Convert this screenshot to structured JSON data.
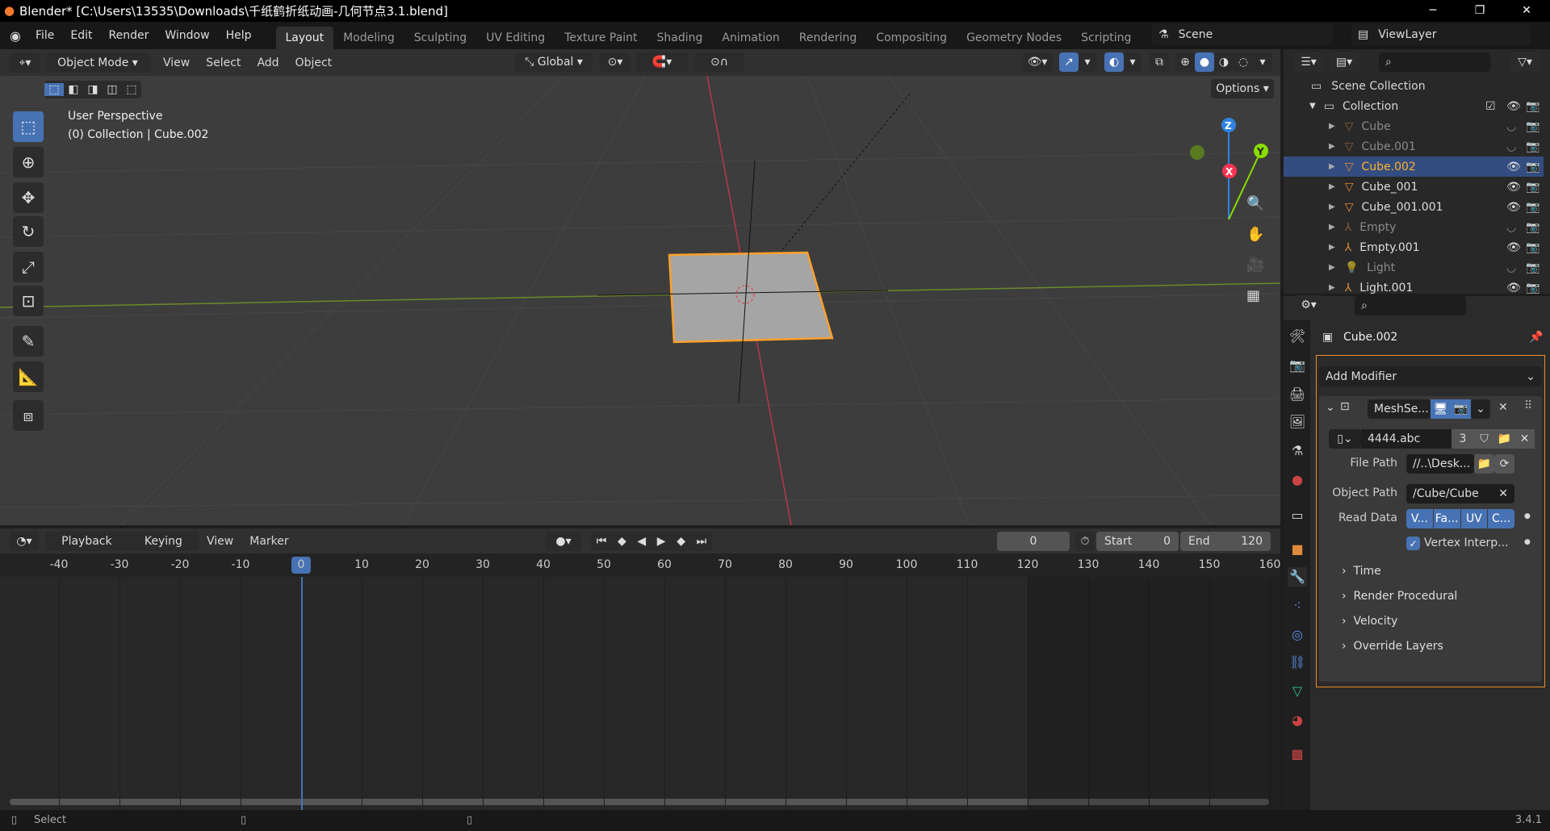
{
  "window": {
    "title": "Blender* [C:\\Users\\13535\\Downloads\\千纸鹤折纸动画-几何节点3.1.blend]",
    "minimize": "─",
    "maximize": "❐",
    "close": "✕"
  },
  "menu": [
    "File",
    "Edit",
    "Render",
    "Window",
    "Help"
  ],
  "workspaces": [
    "Layout",
    "Modeling",
    "Sculpting",
    "UV Editing",
    "Texture Paint",
    "Shading",
    "Animation",
    "Rendering",
    "Compositing",
    "Geometry Nodes",
    "Scripting",
    "+"
  ],
  "active_workspace": "Layout",
  "scene": {
    "name": "Scene",
    "view_layer": "ViewLayer"
  },
  "viewport": {
    "mode": "Object Mode",
    "menus": [
      "View",
      "Select",
      "Add",
      "Object"
    ],
    "transform_orientation": "Global",
    "options": "Options",
    "overlay_line1": "User Perspective",
    "overlay_line2": "(0) Collection | Cube.002",
    "gizmo": {
      "z": "Z",
      "y": "Y",
      "x": "X"
    }
  },
  "timeline": {
    "menus": [
      "Playback",
      "Keying",
      "View",
      "Marker"
    ],
    "current_frame": "0",
    "start_label": "Start",
    "start": "0",
    "end_label": "End",
    "end": "120",
    "ticks": [
      -40,
      -30,
      -20,
      -10,
      0,
      10,
      20,
      30,
      40,
      50,
      60,
      70,
      80,
      90,
      100,
      110,
      120,
      130,
      140,
      150,
      160
    ],
    "playhead": 0
  },
  "outliner": {
    "scene_collection": "Scene Collection",
    "collection": "Collection",
    "items": [
      {
        "name": "Cube",
        "type": "mesh",
        "hidden": true,
        "selected": false
      },
      {
        "name": "Cube.001",
        "type": "mesh",
        "hidden": true,
        "selected": false
      },
      {
        "name": "Cube.002",
        "type": "mesh",
        "hidden": false,
        "selected": true
      },
      {
        "name": "Cube_001",
        "type": "mesh",
        "hidden": false,
        "selected": false
      },
      {
        "name": "Cube_001.001",
        "type": "mesh",
        "hidden": false,
        "selected": false
      },
      {
        "name": "Empty",
        "type": "empty",
        "hidden": true,
        "selected": false
      },
      {
        "name": "Empty.001",
        "type": "empty",
        "hidden": false,
        "selected": false
      },
      {
        "name": "Light",
        "type": "light",
        "hidden": true,
        "selected": false
      },
      {
        "name": "Light.001",
        "type": "empty",
        "hidden": false,
        "selected": false
      }
    ]
  },
  "properties": {
    "object": "Cube.002",
    "add_modifier": "Add Modifier",
    "modifier": {
      "name": "MeshSe...",
      "cache_file": "4444.abc",
      "users": "3",
      "file_path_label": "File Path",
      "file_path": "//..\\Desk...",
      "object_path_label": "Object Path",
      "object_path": "/Cube/Cube",
      "read_data_label": "Read Data",
      "read_data": [
        "V...",
        "Fa...",
        "UV",
        "C..."
      ],
      "vertex_interp": "Vertex Interp...",
      "vertex_interp_checked": true,
      "panels": [
        "Time",
        "Render Procedural",
        "Velocity",
        "Override Layers"
      ]
    }
  },
  "status": {
    "select": "Select",
    "version": "3.4.1"
  },
  "colors": {
    "accent": "#4772b3",
    "selected_orange": "#ffaf29",
    "x_axis": "#ff3352",
    "y_axis": "#8bdc00",
    "z_axis": "#2f83e3"
  }
}
